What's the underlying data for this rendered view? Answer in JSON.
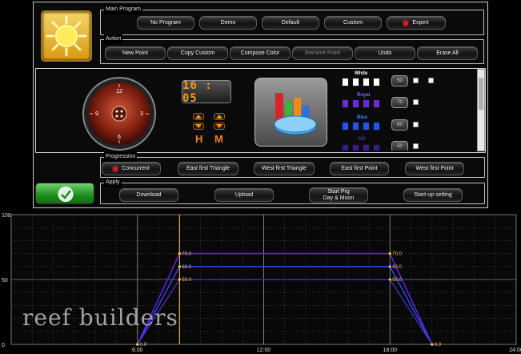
{
  "main_program": {
    "title": "Main Program",
    "buttons": [
      "No Program",
      "Demo",
      "Default",
      "Custom",
      "Expert"
    ]
  },
  "action": {
    "title": "Action",
    "buttons": [
      "New Point",
      "Copy Custom",
      "Compose Color",
      "Remove Point",
      "Undo",
      "Erase All"
    ]
  },
  "clock": {
    "time": "16 : 05",
    "h_label": "H",
    "m_label": "M"
  },
  "dial": {
    "numbers": [
      "12",
      "3",
      "6",
      "9"
    ]
  },
  "channels": [
    {
      "name": "White",
      "value": "50",
      "color": "#f5f5f5"
    },
    {
      "name": "Royal",
      "value": "70",
      "color": "#6a2bd6"
    },
    {
      "name": "Blue",
      "value": "60",
      "color": "#1f55ee"
    },
    {
      "name": "UV",
      "value": "50",
      "color": "#3a1b8f"
    }
  ],
  "progression": {
    "title": "Progression",
    "buttons": [
      "Concurrent",
      "East first Triangle",
      "West first Triangle",
      "East first Point",
      "West first Point"
    ]
  },
  "apply": {
    "title": "Apply",
    "buttons": [
      "Download",
      "Upload",
      "Start Prg\nDay & Moon",
      "Start-up setting"
    ]
  },
  "chart_data": {
    "type": "line",
    "x": [
      "00:00",
      "06:00",
      "08:00",
      "18:00",
      "20:00",
      "24:00"
    ],
    "x_ticks": [
      "6:00",
      "12:00",
      "18:00",
      "24:00"
    ],
    "y_ticks": [
      "100",
      "50",
      "0"
    ],
    "ylim": [
      0,
      100
    ],
    "xlim": [
      0,
      24
    ],
    "grid": true,
    "series": [
      {
        "name": "White",
        "color": "#8a3bff",
        "points": [
          [
            6,
            0
          ],
          [
            8,
            70
          ],
          [
            18,
            70
          ],
          [
            20,
            0
          ]
        ]
      },
      {
        "name": "Royal",
        "color": "#5a1fe0",
        "points": [
          [
            6,
            0
          ],
          [
            8,
            70
          ],
          [
            18,
            70
          ],
          [
            20,
            0
          ]
        ]
      },
      {
        "name": "Blue",
        "color": "#2a4cff",
        "points": [
          [
            6,
            0
          ],
          [
            8,
            60
          ],
          [
            18,
            60
          ],
          [
            20,
            0
          ]
        ]
      },
      {
        "name": "UV",
        "color": "#4a2cb0",
        "points": [
          [
            6,
            0
          ],
          [
            8,
            50
          ],
          [
            18,
            50
          ],
          [
            20,
            0
          ]
        ]
      }
    ],
    "point_labels": [
      "0.0",
      "70.0",
      "60.0",
      "50.0",
      "70.0",
      "60.0",
      "50.0",
      "0.0"
    ],
    "cursor_x": 8
  },
  "watermark": "reef builders"
}
